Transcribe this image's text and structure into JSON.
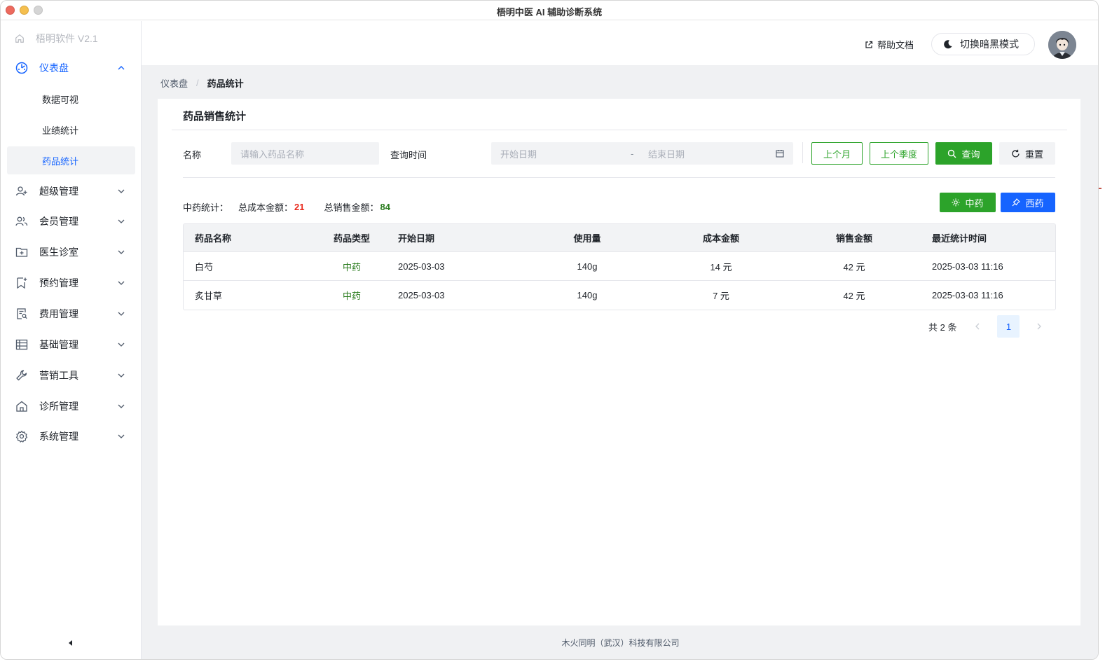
{
  "window": {
    "title": "梧明中医 AI 辅助诊断系统"
  },
  "sidebar": {
    "brand": "梧明软件 V2.1",
    "items": [
      {
        "label": "仪表盘",
        "icon": "dashboard-icon",
        "expanded": true
      },
      {
        "label": "超级管理",
        "icon": "user-add-icon"
      },
      {
        "label": "会员管理",
        "icon": "members-icon"
      },
      {
        "label": "医生诊室",
        "icon": "folder-add-icon"
      },
      {
        "label": "预约管理",
        "icon": "bookmark-icon"
      },
      {
        "label": "费用管理",
        "icon": "file-search-icon"
      },
      {
        "label": "基础管理",
        "icon": "table-icon"
      },
      {
        "label": "营销工具",
        "icon": "wrench-icon"
      },
      {
        "label": "诊所管理",
        "icon": "home-icon"
      },
      {
        "label": "系统管理",
        "icon": "settings-icon"
      }
    ],
    "subitems": [
      {
        "label": "数据可视"
      },
      {
        "label": "业绩统计"
      },
      {
        "label": "药品统计",
        "active": true
      }
    ]
  },
  "topbar": {
    "help": "帮助文档",
    "theme_toggle": "切换暗黑模式"
  },
  "breadcrumb": {
    "root": "仪表盘",
    "current": "药品统计"
  },
  "card": {
    "title": "药品销售统计"
  },
  "filters": {
    "name_label": "名称",
    "name_placeholder": "请输入药品名称",
    "time_label": "查询时间",
    "start_placeholder": "开始日期",
    "range_sep": "-",
    "end_placeholder": "结束日期",
    "last_month": "上个月",
    "last_quarter": "上个季度",
    "search": "查询",
    "reset": "重置"
  },
  "stats": {
    "prefix": "中药统计：",
    "cost_label": "总成本金额：",
    "cost_value": "21",
    "sales_label": "总销售金额：",
    "sales_value": "84"
  },
  "toggle": {
    "chinese": "中药",
    "western": "西药"
  },
  "table": {
    "headers": [
      "药品名称",
      "药品类型",
      "开始日期",
      "使用量",
      "成本金额",
      "销售金额",
      "最近统计时间"
    ],
    "rows": [
      [
        "白芍",
        "中药",
        "2025-03-03",
        "140g",
        "14 元",
        "42 元",
        "2025-03-03 11:16"
      ],
      [
        "炙甘草",
        "中药",
        "2025-03-03",
        "140g",
        "7 元",
        "42 元",
        "2025-03-03 11:16"
      ]
    ]
  },
  "pagination": {
    "total": "共 2 条",
    "page": "1"
  },
  "footer": "木火同明（武汉）科技有限公司",
  "colors": {
    "primary": "#1664ff",
    "green": "#2ca32a",
    "red": "#e8291c"
  }
}
